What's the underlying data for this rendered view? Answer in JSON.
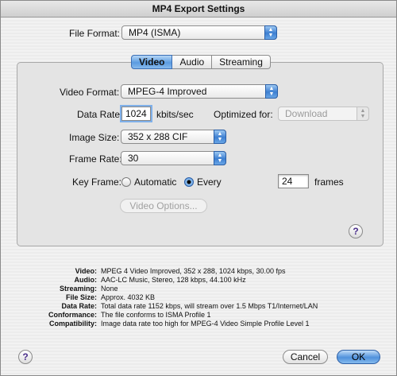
{
  "window": {
    "title": "MP4 Export Settings"
  },
  "file_format": {
    "label": "File Format:",
    "value": "MP4 (ISMA)"
  },
  "tabs": [
    {
      "label": "Video",
      "active": true
    },
    {
      "label": "Audio",
      "active": false
    },
    {
      "label": "Streaming",
      "active": false
    }
  ],
  "video": {
    "format_label": "Video Format:",
    "format_value": "MPEG-4 Improved",
    "data_rate_label": "Data Rate:",
    "data_rate_value": "1024",
    "data_rate_unit": "kbits/sec",
    "optimized_label": "Optimized for:",
    "optimized_value": "Download",
    "image_size_label": "Image Size:",
    "image_size_value": "352 x 288 CIF",
    "frame_rate_label": "Frame Rate:",
    "frame_rate_value": "30",
    "key_frame_label": "Key Frame:",
    "automatic_label": "Automatic",
    "every_label": "Every",
    "key_frame_selected": "Every",
    "frames_value": "24",
    "frames_unit": "frames",
    "options_button": "Video Options..."
  },
  "summary": [
    {
      "key": "Video:",
      "value": "MPEG 4 Video Improved, 352 x 288, 1024 kbps, 30.00 fps"
    },
    {
      "key": "Audio:",
      "value": "AAC-LC Music, Stereo, 128 kbps, 44.100 kHz"
    },
    {
      "key": "Streaming:",
      "value": "None"
    },
    {
      "key": "File Size:",
      "value": "Approx. 4032 KB"
    },
    {
      "key": "Data Rate:",
      "value": "Total data rate 1152 kbps, will stream over 1.5 Mbps T1/Internet/LAN"
    },
    {
      "key": "Conformance:",
      "value": "The file conforms to ISMA Profile 1"
    },
    {
      "key": "Compatibility:",
      "value": "Image data rate too high for MPEG-4 Video Simple Profile Level 1"
    }
  ],
  "buttons": {
    "cancel": "Cancel",
    "ok": "OK",
    "help": "?"
  }
}
